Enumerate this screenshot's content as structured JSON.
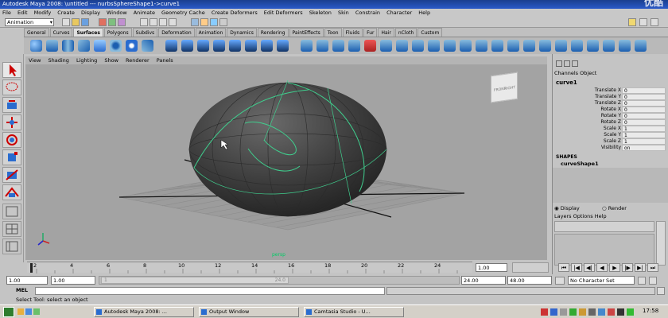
{
  "title_bar": {
    "text": "Autodesk Maya 2008:  \\untitled  ---  nurbsSphereShape1->curve1",
    "watermark": "优酷"
  },
  "menu_bar": [
    "File",
    "Edit",
    "Modify",
    "Create",
    "Display",
    "Window",
    "Animate",
    "Geometry Cache",
    "Create Deformers",
    "Edit Deformers",
    "Skeleton",
    "Skin",
    "Constrain",
    "Character",
    "Help"
  ],
  "status_line": {
    "mode": "Animation"
  },
  "shelf_tabs": [
    "General",
    "Curves",
    "Surfaces",
    "Polygons",
    "Subdivs",
    "Deformation",
    "Animation",
    "Dynamics",
    "Rendering",
    "PaintEffects",
    "Toon",
    "Fluids",
    "Fur",
    "Hair",
    "nCloth",
    "Custom"
  ],
  "active_shelf_tab": "Surfaces",
  "viewport": {
    "menus": [
      "View",
      "Shading",
      "Lighting",
      "Show",
      "Renderer",
      "Panels"
    ],
    "camera_label": "persp",
    "view_cube": {
      "front": "FRONT",
      "right": "RIGHT"
    },
    "colors": {
      "curve": "#3fcf8e",
      "background": "#a3a3a3"
    }
  },
  "channel_box": {
    "tabs": [
      "Channels",
      "Object"
    ],
    "object_name": "curve1",
    "attributes": [
      {
        "name": "Translate X",
        "value": "0"
      },
      {
        "name": "Translate Y",
        "value": "0"
      },
      {
        "name": "Translate Z",
        "value": "0"
      },
      {
        "name": "Rotate X",
        "value": "0"
      },
      {
        "name": "Rotate Y",
        "value": "0"
      },
      {
        "name": "Rotate Z",
        "value": "0"
      },
      {
        "name": "Scale X",
        "value": "1"
      },
      {
        "name": "Scale Y",
        "value": "1"
      },
      {
        "name": "Scale Z",
        "value": "1"
      },
      {
        "name": "Visibility",
        "value": "on"
      }
    ],
    "shapes_header": "SHAPES",
    "shape_name": "curveShape1"
  },
  "layer_editor": {
    "radio_display": "Display",
    "radio_render": "Render",
    "menus": [
      "Layers",
      "Options",
      "Help"
    ]
  },
  "timeline": {
    "ticks": [
      "2",
      "4",
      "6",
      "8",
      "10",
      "12",
      "14",
      "16",
      "18",
      "20",
      "22",
      "24"
    ],
    "current_frame": "1.00"
  },
  "range_slider": {
    "start_time": "1.00",
    "playback_start": "1.00",
    "range_start_label": "1",
    "range_end_label": "24.0",
    "playback_end": "24.00",
    "end_time": "48.00",
    "character_set": "No Character Set"
  },
  "command_line": {
    "label": "MEL"
  },
  "help_line": "Select Tool: select an object",
  "taskbar": {
    "items": [
      "Autodesk Maya 2008: ...",
      "Output Window",
      "Camtasia Studio - U..."
    ],
    "clock": "17:58"
  }
}
